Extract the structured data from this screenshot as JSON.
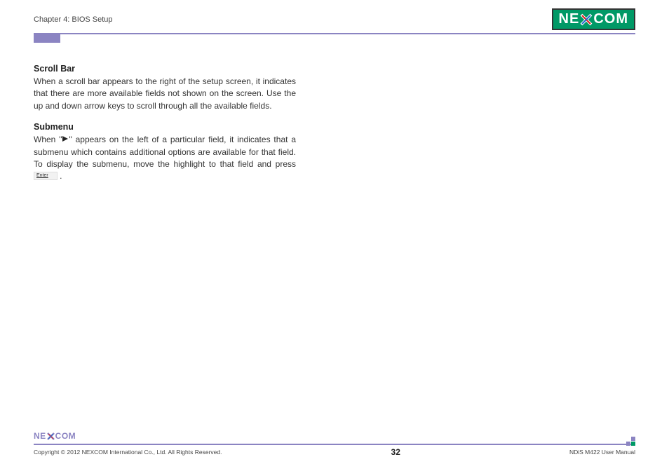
{
  "header": {
    "chapter": "Chapter 4: BIOS Setup",
    "logo_left": "NE",
    "logo_right": "COM"
  },
  "sections": {
    "s1": {
      "heading": "Scroll Bar",
      "body": "When a scroll bar appears to the right of the setup screen, it indicates that there are more available fields not shown on the screen. Use the up and down arrow keys to scroll through all the available fields."
    },
    "s2": {
      "heading": "Submenu",
      "body_pre": "When \"",
      "body_mid": "\" appears on the left of a particular field, it indicates that a submenu which contains additional options are available for that field. To display the submenu, move the highlight to that field and press ",
      "body_post": " .",
      "key_label": "Enter"
    }
  },
  "footer": {
    "logo_left": "NE",
    "logo_right": "COM",
    "copyright": "Copyright © 2012 NEXCOM International Co., Ltd. All Rights Reserved.",
    "page": "32",
    "manual": "NDiS M422 User Manual"
  }
}
